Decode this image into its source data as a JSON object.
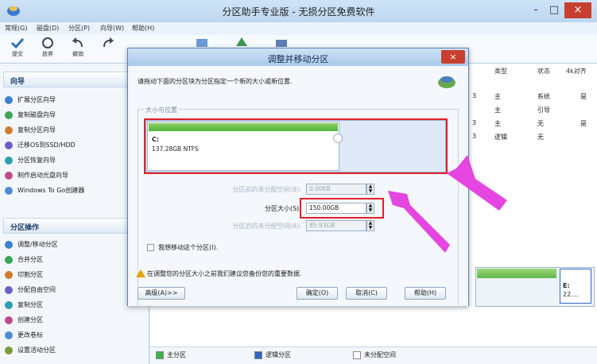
{
  "window": {
    "title": "分区助手专业版 - 无损分区免费软件",
    "controls": [
      "-",
      "□",
      "×"
    ]
  },
  "menu": [
    "常规(G)",
    "磁盘(D)",
    "分区(P)",
    "向导(W)",
    "帮助(H)"
  ],
  "toolbar": [
    {
      "label": "提交",
      "icon": "check-icon"
    },
    {
      "label": "放弃",
      "icon": "discard-icon"
    },
    {
      "label": "撤销",
      "icon": "undo-icon"
    },
    {
      "label": "",
      "icon": "redo-icon"
    },
    {
      "label": "",
      "icon": "disk-icon"
    },
    {
      "label": "",
      "icon": "tree-icon"
    },
    {
      "label": "",
      "icon": "drive-icon"
    }
  ],
  "left_panel": {
    "wizard_title": "向导",
    "wizards": [
      "扩展分区向导",
      "复制磁盘向导",
      "复制分区向导",
      "迁移OS到SSD/HDD",
      "分区恢复向导",
      "制作启动光盘向导",
      "Windows To Go创建器"
    ],
    "ops_title": "分区操作",
    "ops": [
      "调整/移动分区",
      "合并分区",
      "切割分区",
      "分配自由空间",
      "复制分区",
      "创建分区",
      "更改卷标",
      "设置活动分区"
    ]
  },
  "table": {
    "headers": [
      "类型",
      "状态",
      "4k对齐"
    ],
    "rows": [
      {
        "prefix": "3",
        "type": "主",
        "status": "系统",
        "align": "是"
      },
      {
        "prefix": "",
        "type": "主",
        "status": "引导",
        "align": ""
      },
      {
        "prefix": "3",
        "type": "主",
        "status": "无",
        "align": "是"
      },
      {
        "prefix": "3",
        "type": "逻辑",
        "status": "无",
        "align": ""
      }
    ],
    "disk_label_letter": "E:",
    "disk_label_size": "22...."
  },
  "dialog": {
    "title": "调整并移动分区",
    "close": "×",
    "instruction": "请拖动下面的分区块为分区指定一个新的大小或新位置.",
    "group_label": "大小与位置",
    "partition_letter": "C:",
    "partition_info": "137.28GB NTFS",
    "partition_fill": 0.64,
    "unalloc_before_label": "分区前的未分配空间(B):",
    "unalloc_before_value": "0.00KB",
    "size_label": "分区大小(S):",
    "size_value": "150.00GB",
    "unalloc_after_label": "分区后的未分配空间(A):",
    "unalloc_after_value": "85.93GB",
    "checkbox_label": "我想移动这个分区(I).",
    "warning": "在调整您的分区大小之前我们建议您备份您的重要数据.",
    "buttons": {
      "advanced": "高级(A)>>",
      "ok": "确定(O)",
      "cancel": "取消(C)",
      "help": "帮助(H)"
    }
  },
  "legend": [
    "主分区",
    "逻辑分区",
    "未分配空间"
  ],
  "colors": {
    "primary": "#3db04a",
    "logical": "#2e67c6",
    "unallocated": "#ffffff",
    "highlight": "#e0202a",
    "arrow": "#e545e0"
  }
}
